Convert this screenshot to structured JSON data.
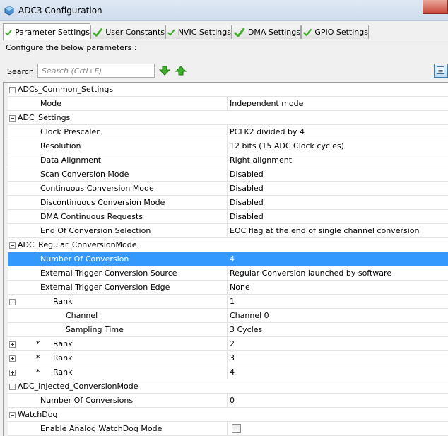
{
  "window": {
    "title": "ADC3 Configuration"
  },
  "tabs": [
    {
      "label": "Parameter Settings"
    },
    {
      "label": "User Constants"
    },
    {
      "label": "NVIC Settings"
    },
    {
      "label": "DMA Settings"
    },
    {
      "label": "GPIO Settings"
    }
  ],
  "description": "Configure the below parameters :",
  "search": {
    "label": "Search :",
    "placeholder": "Search (Crtl+F)"
  },
  "rows": [
    {
      "kind": "group",
      "label": "ADCs_Common_Settings"
    },
    {
      "kind": "param",
      "label": "Mode",
      "value": "Independent mode"
    },
    {
      "kind": "group",
      "label": "ADC_Settings"
    },
    {
      "kind": "param",
      "label": "Clock Prescaler",
      "value": "PCLK2 divided by 4"
    },
    {
      "kind": "param",
      "label": "Resolution",
      "value": "12 bits (15 ADC Clock cycles)"
    },
    {
      "kind": "param",
      "label": "Data Alignment",
      "value": "Right alignment"
    },
    {
      "kind": "param",
      "label": "Scan Conversion Mode",
      "value": "Disabled"
    },
    {
      "kind": "param",
      "label": "Continuous Conversion Mode",
      "value": "Disabled"
    },
    {
      "kind": "param",
      "label": "Discontinuous Conversion Mode",
      "value": "Disabled"
    },
    {
      "kind": "param",
      "label": "DMA Continuous Requests",
      "value": "Disabled"
    },
    {
      "kind": "param",
      "label": "End Of Conversion Selection",
      "value": "EOC flag at the end of single channel conversion"
    },
    {
      "kind": "group",
      "label": "ADC_Regular_ConversionMode"
    },
    {
      "kind": "param",
      "label": "Number Of Conversion",
      "value": "4",
      "selected": true
    },
    {
      "kind": "param",
      "label": "External Trigger Conversion Source",
      "value": "Regular Conversion launched by software"
    },
    {
      "kind": "param",
      "label": "External Trigger Conversion Edge",
      "value": "None"
    },
    {
      "kind": "rank",
      "label": "Rank",
      "value": "1",
      "expanded": true
    },
    {
      "kind": "sub",
      "label": "Channel",
      "value": "Channel 0"
    },
    {
      "kind": "sub",
      "label": "Sampling Time",
      "value": "3 Cycles"
    },
    {
      "kind": "rank",
      "label": "Rank",
      "value": "2",
      "star": "*",
      "expanded": false
    },
    {
      "kind": "rank",
      "label": "Rank",
      "value": "3",
      "star": "*",
      "expanded": false
    },
    {
      "kind": "rank",
      "label": "Rank",
      "value": "4",
      "star": "*",
      "expanded": false
    },
    {
      "kind": "group",
      "label": "ADC_Injected_ConversionMode"
    },
    {
      "kind": "param",
      "label": "Number Of Conversions",
      "value": "0"
    },
    {
      "kind": "group",
      "label": "WatchDog"
    },
    {
      "kind": "check",
      "label": "Enable Analog WatchDog Mode",
      "checked": false
    }
  ],
  "colors": {
    "selection": "#3399ff",
    "check_green": "#3fae29"
  }
}
